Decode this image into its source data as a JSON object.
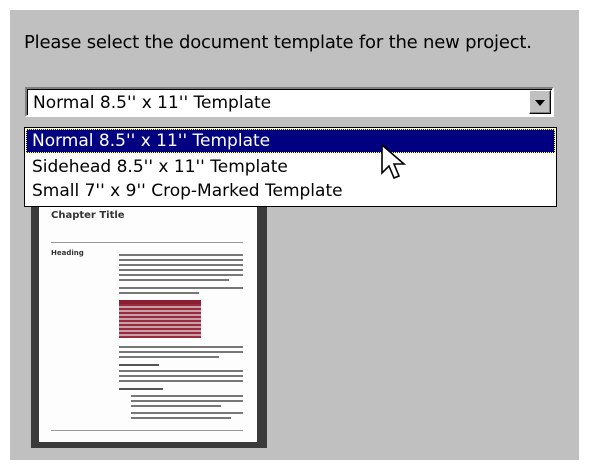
{
  "prompt": "Please select the document template for the new project.",
  "template_select": {
    "value": "Normal 8.5'' x 11'' Template",
    "options": [
      "Normal 8.5'' x 11'' Template",
      "Sidehead 8.5'' x 11'' Template",
      "Small 7'' x 9'' Crop-Marked Template"
    ],
    "selected_index": 0
  },
  "preview": {
    "chapter_title": "Chapter Title",
    "heading": "Heading"
  },
  "colors": {
    "panel": "#c0c0c0",
    "highlight": "#000080"
  },
  "icons": {
    "dropdown": "chevron-down-icon",
    "cursor": "arrow-cursor-icon"
  }
}
